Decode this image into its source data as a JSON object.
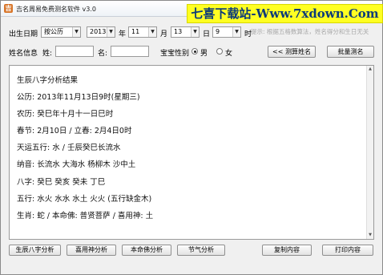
{
  "window": {
    "title": "吉名周易免费测名软件 v3.0",
    "app_icon": "吉"
  },
  "watermark": "七喜下载站-Www.7xdown.Com",
  "birth": {
    "label": "出生日期",
    "calendar": "按公历",
    "year": "2013",
    "year_unit": "年",
    "month": "11",
    "month_unit": "月",
    "day": "13",
    "day_unit": "日",
    "hour": "9",
    "hour_unit": "时"
  },
  "hint": "提示: 根据五格数算法，姓名得分和生日无关",
  "name": {
    "label": "姓名信息",
    "surname_label": "姓:",
    "surname_value": "",
    "given_label": "名:",
    "given_value": "",
    "gender_label": "宝宝性别",
    "male": "男",
    "female": "女",
    "selected_gender": "男",
    "test_button": "<< 测算姓名",
    "batch_button": "批量测名"
  },
  "result": {
    "lines": [
      "生辰八字分析结果",
      "公历: 2013年11月13日9时(星期三)",
      "农历: 癸巳年十月十一日巳时",
      "春节: 2月10日 / 立春: 2月4日0时",
      "天运五行: 水 / 壬辰癸巳长流水",
      "纳音: 长流水 大海水 杨柳木 沙中土",
      "八字: 癸巳 癸亥 癸未 丁巳",
      "五行: 水火 水水 水土 火火 (五行缺金木)",
      "生肖: 蛇 / 本命佛: 普贤菩萨 / 喜用神: 土"
    ]
  },
  "buttons": {
    "bazi": "生辰八字分析",
    "xiyongshen": "喜用神分析",
    "benmingfo": "本命佛分析",
    "jieqi": "节气分析",
    "copy": "复制内容",
    "print": "打印内容"
  }
}
